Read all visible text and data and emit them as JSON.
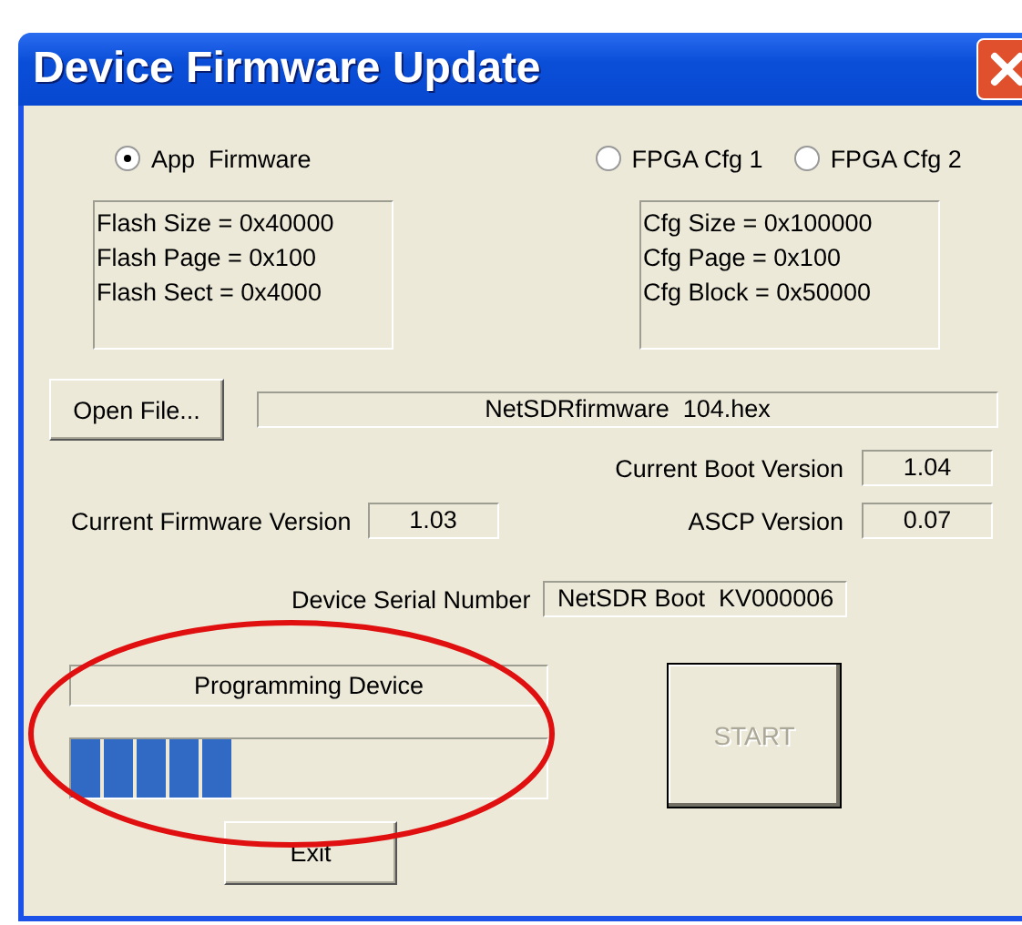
{
  "window": {
    "title": "Device Firmware Update"
  },
  "targets": [
    {
      "label": "App  Firmware",
      "selected": true
    },
    {
      "label": "FPGA Cfg 1",
      "selected": false
    },
    {
      "label": "FPGA Cfg 2",
      "selected": false
    }
  ],
  "app_info": [
    "Flash Size = 0x40000",
    "Flash Page = 0x100",
    "Flash Sect = 0x4000"
  ],
  "cfg_info": [
    "Cfg Size = 0x100000",
    "Cfg Page = 0x100",
    "Cfg Block = 0x50000"
  ],
  "open_file_button": "Open File...",
  "file_name": "NetSDRfirmware  104.hex",
  "boot_version": {
    "label": "Current Boot Version",
    "value": "1.04"
  },
  "firmware_version": {
    "label": "Current Firmware Version",
    "value": "1.03"
  },
  "ascp_version": {
    "label": "ASCP Version",
    "value": "0.07"
  },
  "serial_number": {
    "label": "Device Serial Number",
    "value": "NetSDR Boot  KV000006"
  },
  "status": "Programming Device",
  "progress": {
    "level": 0.34
  },
  "start_button": {
    "label": "START",
    "disabled": true
  },
  "exit_button": "Exit"
}
